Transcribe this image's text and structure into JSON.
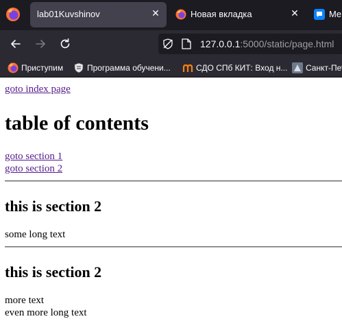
{
  "browser": {
    "tabs": [
      {
        "title": "lab01Kuvshinov",
        "active": true,
        "close": "✕"
      },
      {
        "title": "Новая вкладка",
        "active": false,
        "close": "✕"
      },
      {
        "title": "Me",
        "active": false
      }
    ],
    "url": {
      "host": "127.0.0.1",
      "rest": ":5000/static/page.html"
    },
    "bookmarks": [
      {
        "label": "Приступим",
        "icon": "firefox-icon"
      },
      {
        "label": "Программа обучени...",
        "icon": "shield-icon"
      },
      {
        "label": "СДО СПб КИТ: Вход н...",
        "icon": "moodle-icon"
      },
      {
        "label": "Санкт-Пет",
        "icon": "site-icon"
      }
    ],
    "colors": {
      "chrome_dark": "#1c1b22",
      "chrome_mid": "#2b2a33",
      "active_tab": "#42414d"
    }
  },
  "page": {
    "index_link": "goto index page",
    "toc_title": "table of contents",
    "toc_links": [
      "goto section 1",
      "goto section 2"
    ],
    "sections": [
      {
        "heading": "this is section 2",
        "paragraphs": [
          "some long text"
        ]
      },
      {
        "heading": "this is section 2",
        "paragraphs": [
          "more text",
          "even more long text"
        ]
      }
    ],
    "colors": {
      "link": "#551a8b"
    }
  }
}
